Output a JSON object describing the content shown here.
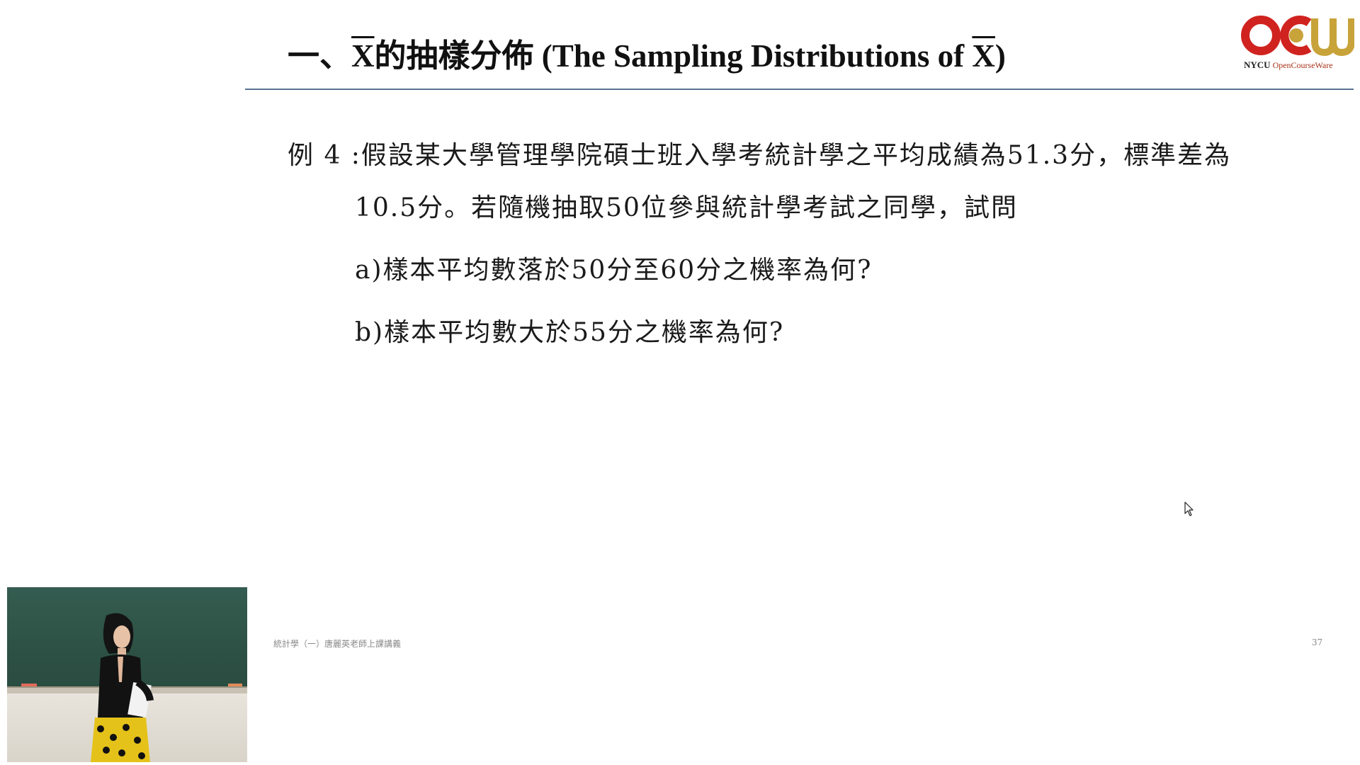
{
  "slide": {
    "title_prefix": "一、",
    "title_xbar": "X",
    "title_middle": "的抽樣分佈 (The Sampling Distributions of ",
    "title_xbar2": "X",
    "title_suffix": ")",
    "logo": {
      "brand": "NYCU",
      "name": "OpenCourseWare"
    },
    "lines": [
      "例 4 :假設某大學管理學院碩士班入學考統計學之平均成績為51.3分，標準差為",
      "10.5分。若隨機抽取50位參與統計學考試之同學，試問",
      "a)樣本平均數落於50分至60分之機率為何?",
      "b)樣本平均數大於55分之機率為何?"
    ],
    "footer_text": "統計學（一）唐麗英老師上課講義",
    "page_number": "37"
  },
  "colors": {
    "rule": "#5a7394",
    "logo_red": "#d0231f",
    "logo_gold": "#c8a33a"
  },
  "icons": {
    "cursor": "mouse-pointer-icon",
    "logo": "ocw-logo-icon"
  }
}
